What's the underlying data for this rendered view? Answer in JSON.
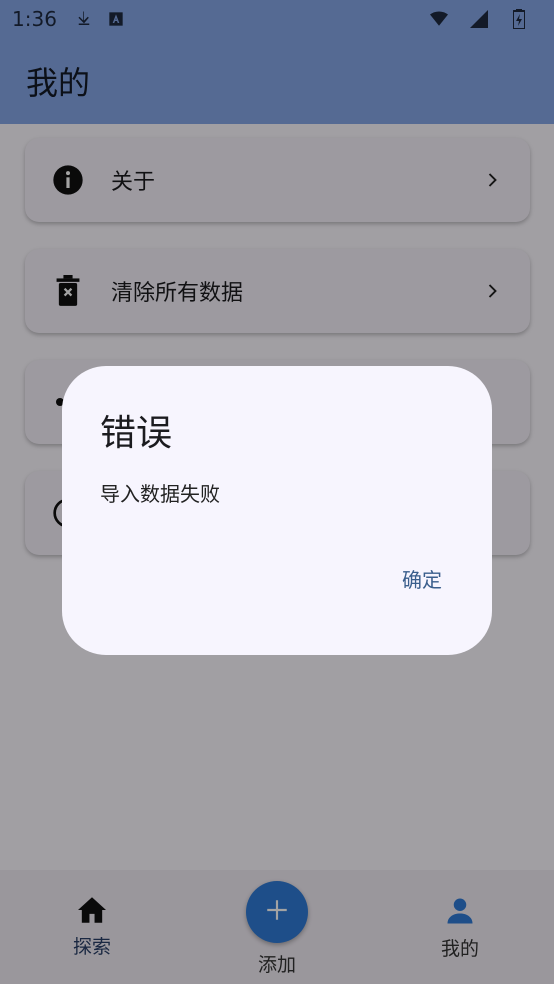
{
  "status_bar": {
    "time": "1:36",
    "icons": [
      "download-icon",
      "text-a-icon",
      "wifi-icon",
      "signal-icon",
      "battery-icon"
    ]
  },
  "app_bar": {
    "title": "我的"
  },
  "list": {
    "items": [
      {
        "label": "关于",
        "icon": "info-icon"
      },
      {
        "label": "清除所有数据",
        "icon": "trash-icon"
      },
      {
        "label": "",
        "icon": "dot-icon"
      },
      {
        "label": "",
        "icon": "circle-icon"
      }
    ]
  },
  "bottom_nav": {
    "items": [
      {
        "label": "探索",
        "icon": "home-icon",
        "active": true
      },
      {
        "label": "添加",
        "icon": "plus-icon"
      },
      {
        "label": "我的",
        "icon": "person-icon"
      }
    ]
  },
  "dialog": {
    "title": "错误",
    "message": "导入数据失败",
    "confirm_label": "确定"
  },
  "colors": {
    "app_bar": "#85a7e6",
    "accent": "#2f7bd6",
    "dialog_bg": "#f7f5fe",
    "button_text": "#3a5e8c"
  }
}
